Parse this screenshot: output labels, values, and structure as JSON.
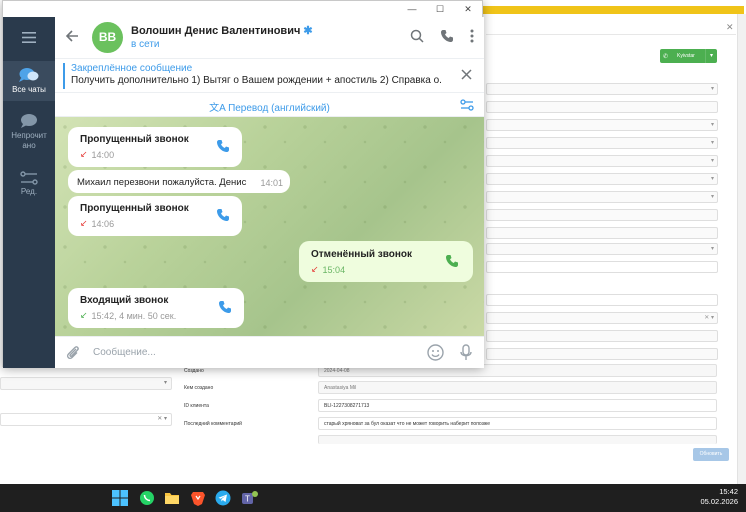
{
  "crm": {
    "call_button": "Kyivstar",
    "labels": {
      "created": "Создано",
      "created_by": "Кем создано",
      "client_id": "ID клиента",
      "last_comment": "Последний комментарий"
    },
    "values": {
      "created": "2024-04-08",
      "created_by": "Anastasiya Mil",
      "client_id": "BLI-1227308271713",
      "last_comment": "старый хряноват за бул оказат что не может говорить наберит попозже"
    },
    "update_button": "Обновить"
  },
  "telegram": {
    "sidebar": {
      "items": [
        {
          "label": "Все чаты",
          "icon": "chat-bubbles-icon",
          "active": true
        },
        {
          "label": "Непрочитано",
          "icon": "unread-chat-icon",
          "active": false
        },
        {
          "label": "Ред.",
          "icon": "edit-folders-icon",
          "active": false
        }
      ],
      "unread_label_line1": "Непрочит",
      "unread_label_line2": "ано"
    },
    "header": {
      "avatar_initials": "ВВ",
      "avatar_color": "#6bc15e",
      "name": "Волошин Денис Валентинович",
      "verified_icon": "star-badge-icon",
      "status": "в сети"
    },
    "pinned": {
      "title": "Закреплённое сообщение",
      "text": "Получить дополнительно  1) Вытяг о Вашем рождении + апостиль 2) Справка о..."
    },
    "translate": {
      "label": "Перевод (английский)"
    },
    "messages": [
      {
        "type": "call",
        "direction": "in",
        "title": "Пропущенный звонок",
        "meta": "14:00",
        "arrow": "missed"
      },
      {
        "type": "text",
        "direction": "in",
        "text": "Михаил перезвони пожалуйста. Денис",
        "time": "14:01"
      },
      {
        "type": "call",
        "direction": "in",
        "title": "Пропущенный звонок",
        "meta": "14:06",
        "arrow": "missed"
      },
      {
        "type": "call",
        "direction": "out",
        "title": "Отменённый звонок",
        "meta": "15:04",
        "arrow": "cancelled"
      },
      {
        "type": "call",
        "direction": "in",
        "title": "Входящий звонок",
        "meta": "15:42, 4 мин. 50 сек.",
        "arrow": "incoming"
      }
    ],
    "composer": {
      "placeholder": "Сообщение..."
    },
    "accent": "#3d9be9"
  },
  "taskbar": {
    "time": "15:42",
    "date": "05.02.2026",
    "apps": [
      "windows-start-icon",
      "whatsapp-icon",
      "file-explorer-icon",
      "brave-icon",
      "telegram-icon",
      "teams-icon"
    ]
  }
}
